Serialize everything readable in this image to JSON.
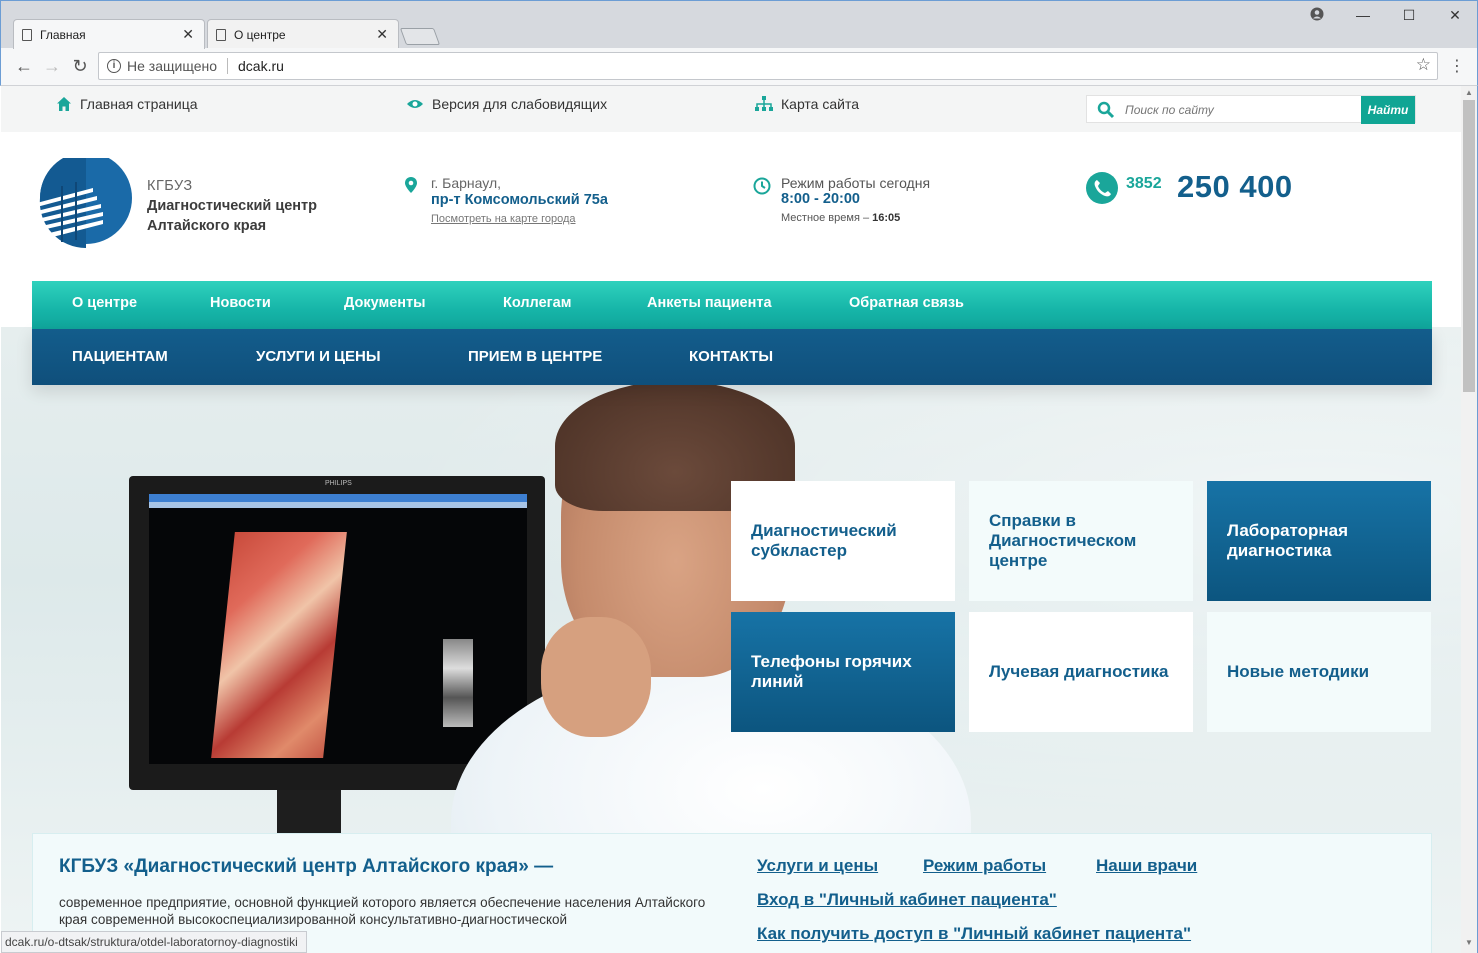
{
  "browser": {
    "tabs": [
      {
        "label": "Главная",
        "active": true
      },
      {
        "label": "О центре",
        "active": false
      }
    ],
    "address": {
      "security_label": "Не защищено",
      "url": "dcak.ru"
    },
    "status_url": "dcak.ru/o-dtsak/struktura/otdel-laboratornoy-diagnostiki"
  },
  "utility": {
    "home_label": "Главная страница",
    "vision_label": "Версия для слабовидящих",
    "sitemap_label": "Карта сайта",
    "search_placeholder": "Поиск по сайту",
    "search_button": "Найти"
  },
  "header": {
    "org_abbr": "КГБУЗ",
    "org_name_line1": "Диагностический центр",
    "org_name_line2": "Алтайского края",
    "address_city": "г. Барнаул,",
    "address_street": "пр-т Комсомольский 75а",
    "map_link": "Посмотреть на карте города",
    "hours_title": "Режим работы сегодня",
    "hours_value": "8:00 - 20:00",
    "local_time_label": "Местное время –",
    "local_time_value": "16:05",
    "phone_code": "3852",
    "phone_number": "250 400"
  },
  "nav_primary": [
    "О центре",
    "Новости",
    "Документы",
    "Коллегам",
    "Анкеты пациента",
    "Обратная связь"
  ],
  "nav_secondary": [
    "ПАЦИЕНТАМ",
    "УСЛУГИ И ЦЕНЫ",
    "ПРИЕМ В ЦЕНТРЕ",
    "КОНТАКТЫ"
  ],
  "tiles": [
    {
      "label": "Диагностический субкластер",
      "style": "light"
    },
    {
      "label": "Справки в Диагностическом центре",
      "style": "pale"
    },
    {
      "label": "Лабораторная диагностика",
      "style": "dark"
    },
    {
      "label": "Телефоны горячих линий",
      "style": "dark"
    },
    {
      "label": "Лучевая диагностика",
      "style": "light"
    },
    {
      "label": "Новые методики",
      "style": "pale"
    }
  ],
  "info": {
    "title": "КГБУЗ «Диагностический центр Алтайского края» —",
    "description": "современное предприятие, основной функцией которого является обеспечение населения Алтайского края современной высокоспециализированной консультативно-диагностической",
    "links": {
      "services": "Услуги и цены",
      "schedule": "Режим работы",
      "doctors": "Наши врачи",
      "cabinet_login": "Вход в \"Личный кабинет пациента\"",
      "cabinet_access": "Как получить доступ в \"Личный кабинет пациента\""
    }
  },
  "colors": {
    "teal": "#16b5a8",
    "navy": "#135f8c",
    "dark_tile": "#0f5f8f"
  }
}
